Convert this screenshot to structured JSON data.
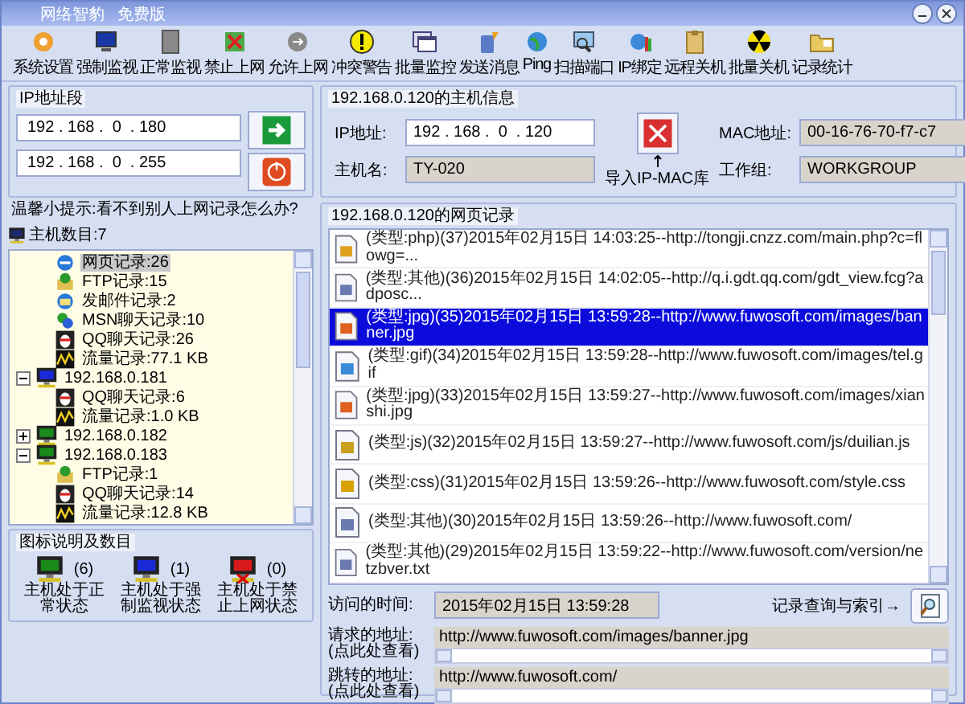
{
  "window": {
    "title": "网络智豹",
    "edition": "免费版"
  },
  "toolbar": [
    {
      "label": "系统设置"
    },
    {
      "label": "强制监视"
    },
    {
      "label": "正常监视"
    },
    {
      "label": "禁止上网"
    },
    {
      "label": "允许上网"
    },
    {
      "label": "冲突警告"
    },
    {
      "label": "批量监控"
    },
    {
      "label": "发送消息"
    },
    {
      "label": "Ping"
    },
    {
      "label": "扫描端口"
    },
    {
      "label": "IP绑定"
    },
    {
      "label": "远程关机"
    },
    {
      "label": "批量关机"
    },
    {
      "label": "记录统计"
    }
  ],
  "ip_range": {
    "title": "IP地址段",
    "start": "192 . 168 .  0  . 180",
    "end": "192 . 168 .  0  . 255"
  },
  "host_info": {
    "title": "192.168.0.120的主机信息",
    "ip_label": "IP地址:",
    "ip": "192 . 168 .  0  . 120",
    "name_label": "主机名:",
    "name": "TY-020",
    "import_label": "导入IP-MAC库",
    "mac_label": "MAC地址:",
    "mac": "00-16-76-70-f7-c7",
    "group_label": "工作组:",
    "group": "WORKGROUP"
  },
  "tip": "温馨小提示:看不到别人上网记录怎么办?",
  "tree": {
    "title": "主机数目:7",
    "partial_children": [
      {
        "kind": "web",
        "label": "网页记录:26",
        "selected": true
      },
      {
        "kind": "ftp",
        "label": "FTP记录:15",
        "selected": false
      },
      {
        "kind": "mail",
        "label": "发邮件记录:2",
        "selected": false
      },
      {
        "kind": "msn",
        "label": "MSN聊天记录:10",
        "selected": false
      },
      {
        "kind": "qq",
        "label": "QQ聊天记录:26",
        "selected": false
      },
      {
        "kind": "traffic",
        "label": "流量记录:77.1 KB",
        "selected": false
      }
    ],
    "hosts": [
      {
        "label": "192.168.0.181",
        "color": "#1a2ad8",
        "expanded": true,
        "children": [
          {
            "kind": "qq",
            "label": "QQ聊天记录:6",
            "selected": false
          },
          {
            "kind": "traffic",
            "label": "流量记录:1.0 KB",
            "selected": false
          }
        ]
      },
      {
        "label": "192.168.0.182",
        "color": "#1a8a1a",
        "expanded": false
      },
      {
        "label": "192.168.0.183",
        "color": "#1a8a1a",
        "expanded": true,
        "children": [
          {
            "kind": "ftp",
            "label": "FTP记录:1",
            "selected": false
          },
          {
            "kind": "qq",
            "label": "QQ聊天记录:14",
            "selected": false
          },
          {
            "kind": "traffic",
            "label": "流量记录:12.8 KB",
            "selected": false
          }
        ]
      }
    ]
  },
  "legend": {
    "title": "图标说明及数目",
    "items": [
      {
        "color": "#1a8a1a",
        "crossed": false,
        "count": "(6)",
        "label": "主机处于正常状态"
      },
      {
        "color": "#1a2ad8",
        "crossed": false,
        "count": "(1)",
        "label": "主机处于强制监视状态"
      },
      {
        "color": "#d81a1a",
        "crossed": true,
        "count": "(0)",
        "label": "主机处于禁止上网状态"
      }
    ]
  },
  "records": {
    "title": "192.168.0.120的网页记录",
    "rows": [
      {
        "kind": "php",
        "text": "(类型:php)(37)2015年02月15日 14:03:25--http://tongji.cnzz.com/main.php?c=flowg=...",
        "selected": false
      },
      {
        "kind": "other",
        "text": "(类型:其他)(36)2015年02月15日 14:02:05--http://q.i.gdt.qq.com/gdt_view.fcg?adposc...",
        "selected": false
      },
      {
        "kind": "jpg",
        "text": "(类型:jpg)(35)2015年02月15日 13:59:28--http://www.fuwosoft.com/images/banner.jpg",
        "selected": true
      },
      {
        "kind": "gif",
        "text": "(类型:gif)(34)2015年02月15日 13:59:28--http://www.fuwosoft.com/images/tel.gif",
        "selected": false
      },
      {
        "kind": "jpg",
        "text": "(类型:jpg)(33)2015年02月15日 13:59:27--http://www.fuwosoft.com/images/xianshi.jpg",
        "selected": false
      },
      {
        "kind": "js",
        "text": "(类型:js)(32)2015年02月15日 13:59:27--http://www.fuwosoft.com/js/duilian.js",
        "selected": false
      },
      {
        "kind": "css",
        "text": "(类型:css)(31)2015年02月15日 13:59:26--http://www.fuwosoft.com/style.css",
        "selected": false
      },
      {
        "kind": "other",
        "text": "(类型:其他)(30)2015年02月15日 13:59:26--http://www.fuwosoft.com/",
        "selected": false
      },
      {
        "kind": "other",
        "text": "(类型:其他)(29)2015年02月15日 13:59:22--http://www.fuwosoft.com/version/netzbver.txt",
        "selected": false
      }
    ],
    "time_label": "访问的时间:",
    "time": "2015年02月15日 13:59:28",
    "search_label": "记录查询与索引→",
    "request_label": "请求的地址:",
    "request_hint": "(点此处查看)",
    "request": "http://www.fuwosoft.com/images/banner.jpg",
    "redirect_label": "跳转的地址:",
    "redirect_hint": "(点此处查看)",
    "redirect": "http://www.fuwosoft.com/"
  }
}
